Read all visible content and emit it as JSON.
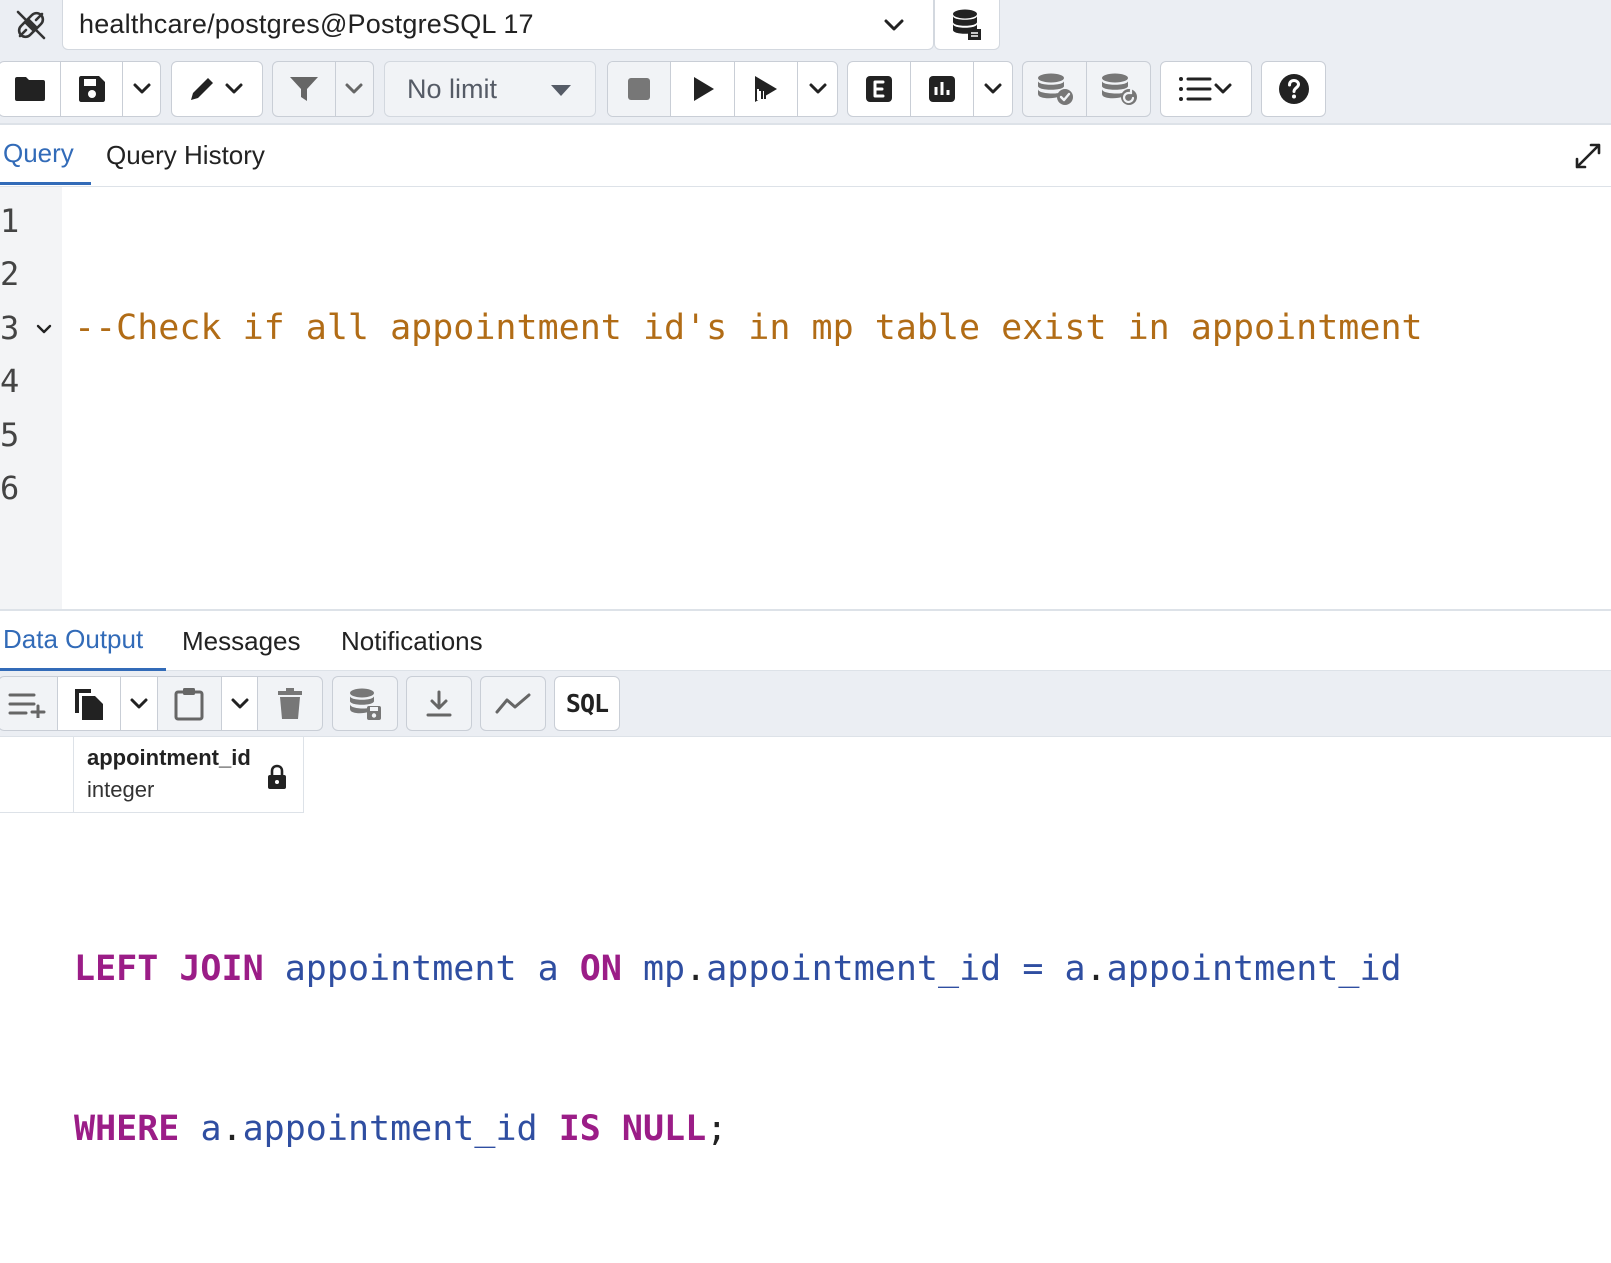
{
  "connection": {
    "label": "healthcare/postgres@PostgreSQL 17"
  },
  "toolbar": {
    "limit_label": "No limit"
  },
  "query_tabs": [
    {
      "label": "Query",
      "active": true
    },
    {
      "label": "Query History",
      "active": false
    }
  ],
  "editor": {
    "line_numbers": [
      "1",
      "2",
      "3",
      "4",
      "5",
      "6"
    ]
  },
  "result_tabs": [
    {
      "label": "Data Output",
      "active": true
    },
    {
      "label": "Messages",
      "active": false
    },
    {
      "label": "Notifications",
      "active": false
    }
  ],
  "result_toolbar": {
    "sql_label": "SQL"
  },
  "grid": {
    "columns": [
      {
        "name": "appointment_id",
        "type": "integer"
      }
    ]
  },
  "colors": {
    "accent": "#326bb8",
    "keyword": "#9b1d87",
    "identifier": "#2f4ea1",
    "comment": "#b16c16",
    "toolbar_bg": "#ebeef3"
  }
}
